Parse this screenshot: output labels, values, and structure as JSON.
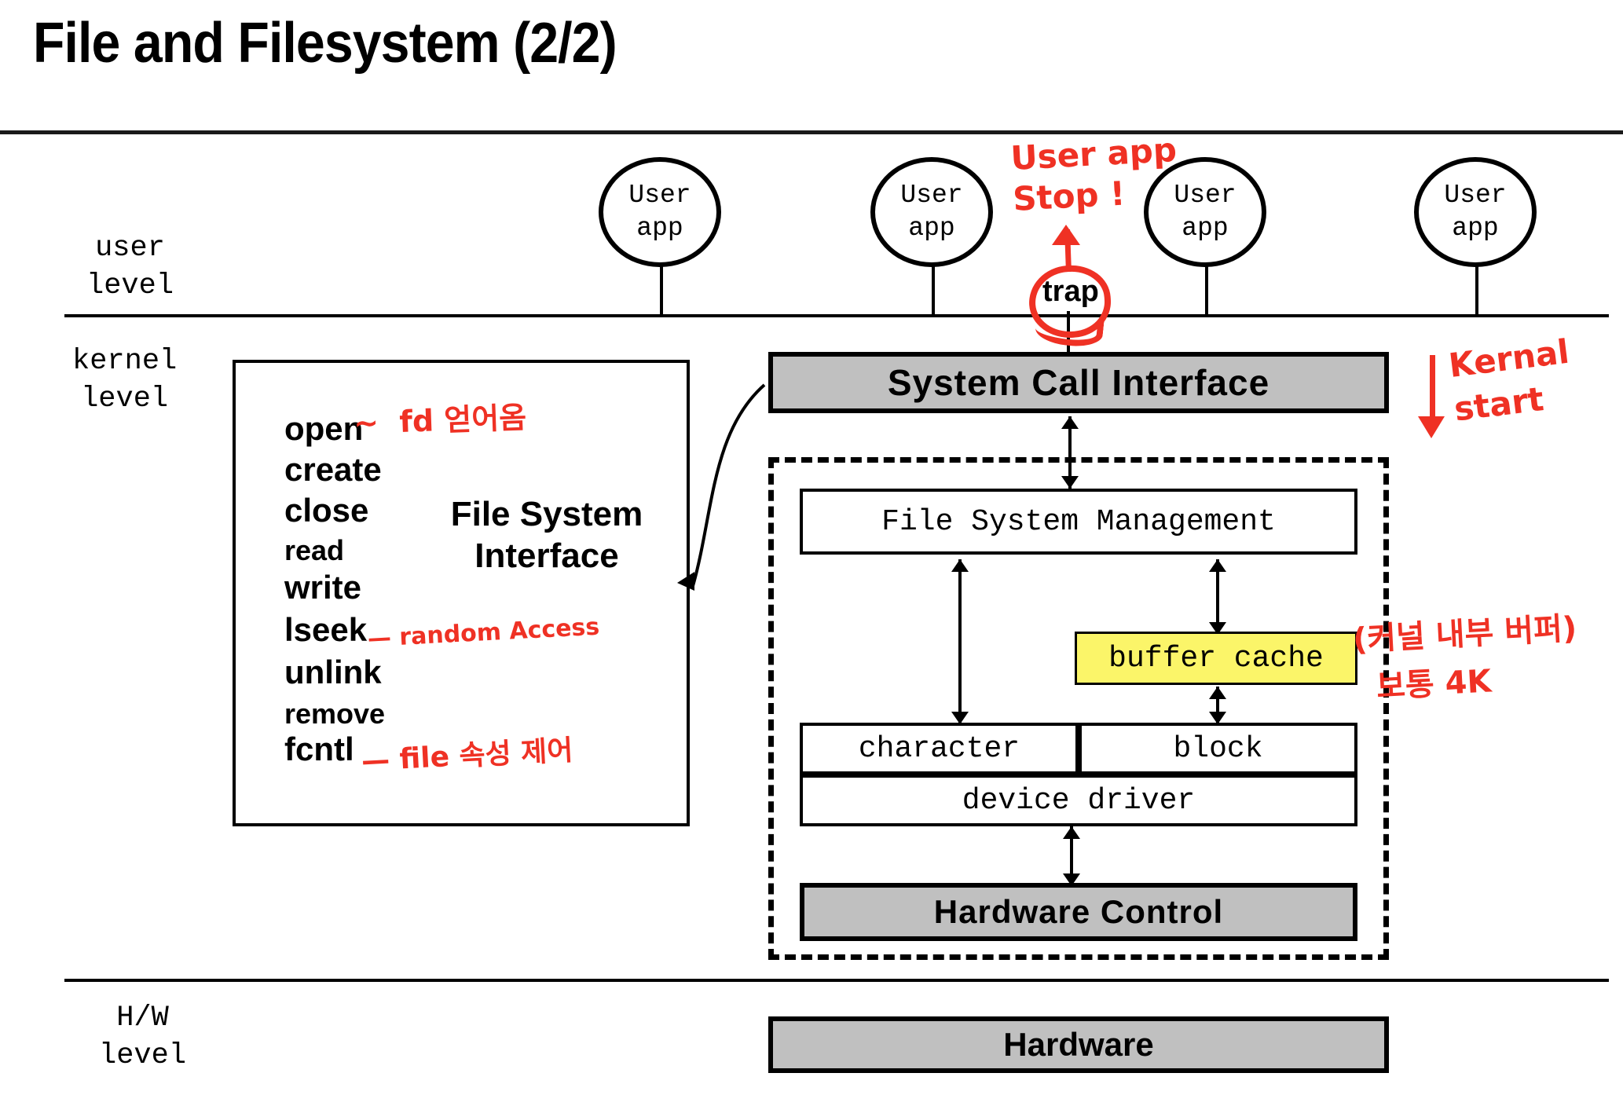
{
  "slide": {
    "title": "File and Filesystem (2/2)"
  },
  "levels": {
    "user": "user\nlevel",
    "kernel": "kernel\nlevel",
    "hardware": "H/W\nlevel"
  },
  "user_apps": [
    {
      "line1": "User",
      "line2": "app"
    },
    {
      "line1": "User",
      "line2": "app"
    },
    {
      "line1": "User",
      "line2": "app"
    },
    {
      "line1": "User",
      "line2": "app"
    }
  ],
  "trap": {
    "label": "trap"
  },
  "file_system_interface": {
    "label": "File System\nInterface",
    "functions": [
      "open",
      "create",
      "close",
      "read",
      "write",
      "lseek",
      "unlink",
      "remove",
      "fcntl"
    ]
  },
  "kernel_blocks": {
    "system_call_interface": "System  Call  Interface",
    "file_system_management": "File System Management",
    "buffer_cache": "buffer cache",
    "character": "character",
    "block": "block",
    "device_driver": "device driver",
    "hardware_control": "Hardware  Control"
  },
  "hardware_block": "Hardware",
  "annotations": [
    {
      "id": "user-app-stop",
      "text": "User app\nStop !",
      "color": "#ef3124"
    },
    {
      "id": "kernal-start",
      "text": "Kernal\nstart",
      "color": "#ef3124"
    },
    {
      "id": "open-note",
      "text": "~  fd 얻어옴",
      "color": "#ef3124"
    },
    {
      "id": "lseek-note",
      "text": "— random Access",
      "color": "#ef3124"
    },
    {
      "id": "fcntl-note",
      "text": "— file 속성 제어",
      "color": "#ef3124"
    },
    {
      "id": "buffer-cache-note-1",
      "text": "(커널 내부 버퍼)",
      "color": "#ef3124"
    },
    {
      "id": "buffer-cache-note-2",
      "text": "보통 4K",
      "color": "#ef3124"
    }
  ],
  "colors": {
    "accent_red": "#ef3124",
    "gray_box": "#c0c0c0",
    "yellow_highlight": "#fbf569",
    "outline": "#000000"
  }
}
